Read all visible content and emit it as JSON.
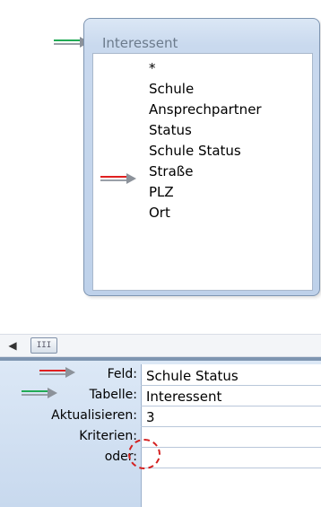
{
  "table": {
    "title": "Interessent",
    "fields": [
      "*",
      "Schule",
      "Ansprechpartner",
      "Status",
      "Schule Status",
      "Straße",
      "PLZ",
      "Ort"
    ]
  },
  "grid": {
    "rows": [
      {
        "label": "Feld:",
        "value": "Schule Status"
      },
      {
        "label": "Tabelle:",
        "value": "Interessent"
      },
      {
        "label": "Aktualisieren:",
        "value": "3"
      },
      {
        "label": "Kriterien:",
        "value": ""
      },
      {
        "label": "oder:",
        "value": ""
      }
    ]
  },
  "scrollbar": {
    "left_glyph": "◀",
    "thumb_glyph": "III"
  },
  "colors": {
    "arrow_green": "#22aa55",
    "arrow_red": "#e02020",
    "table_border": "#7e95b1"
  }
}
